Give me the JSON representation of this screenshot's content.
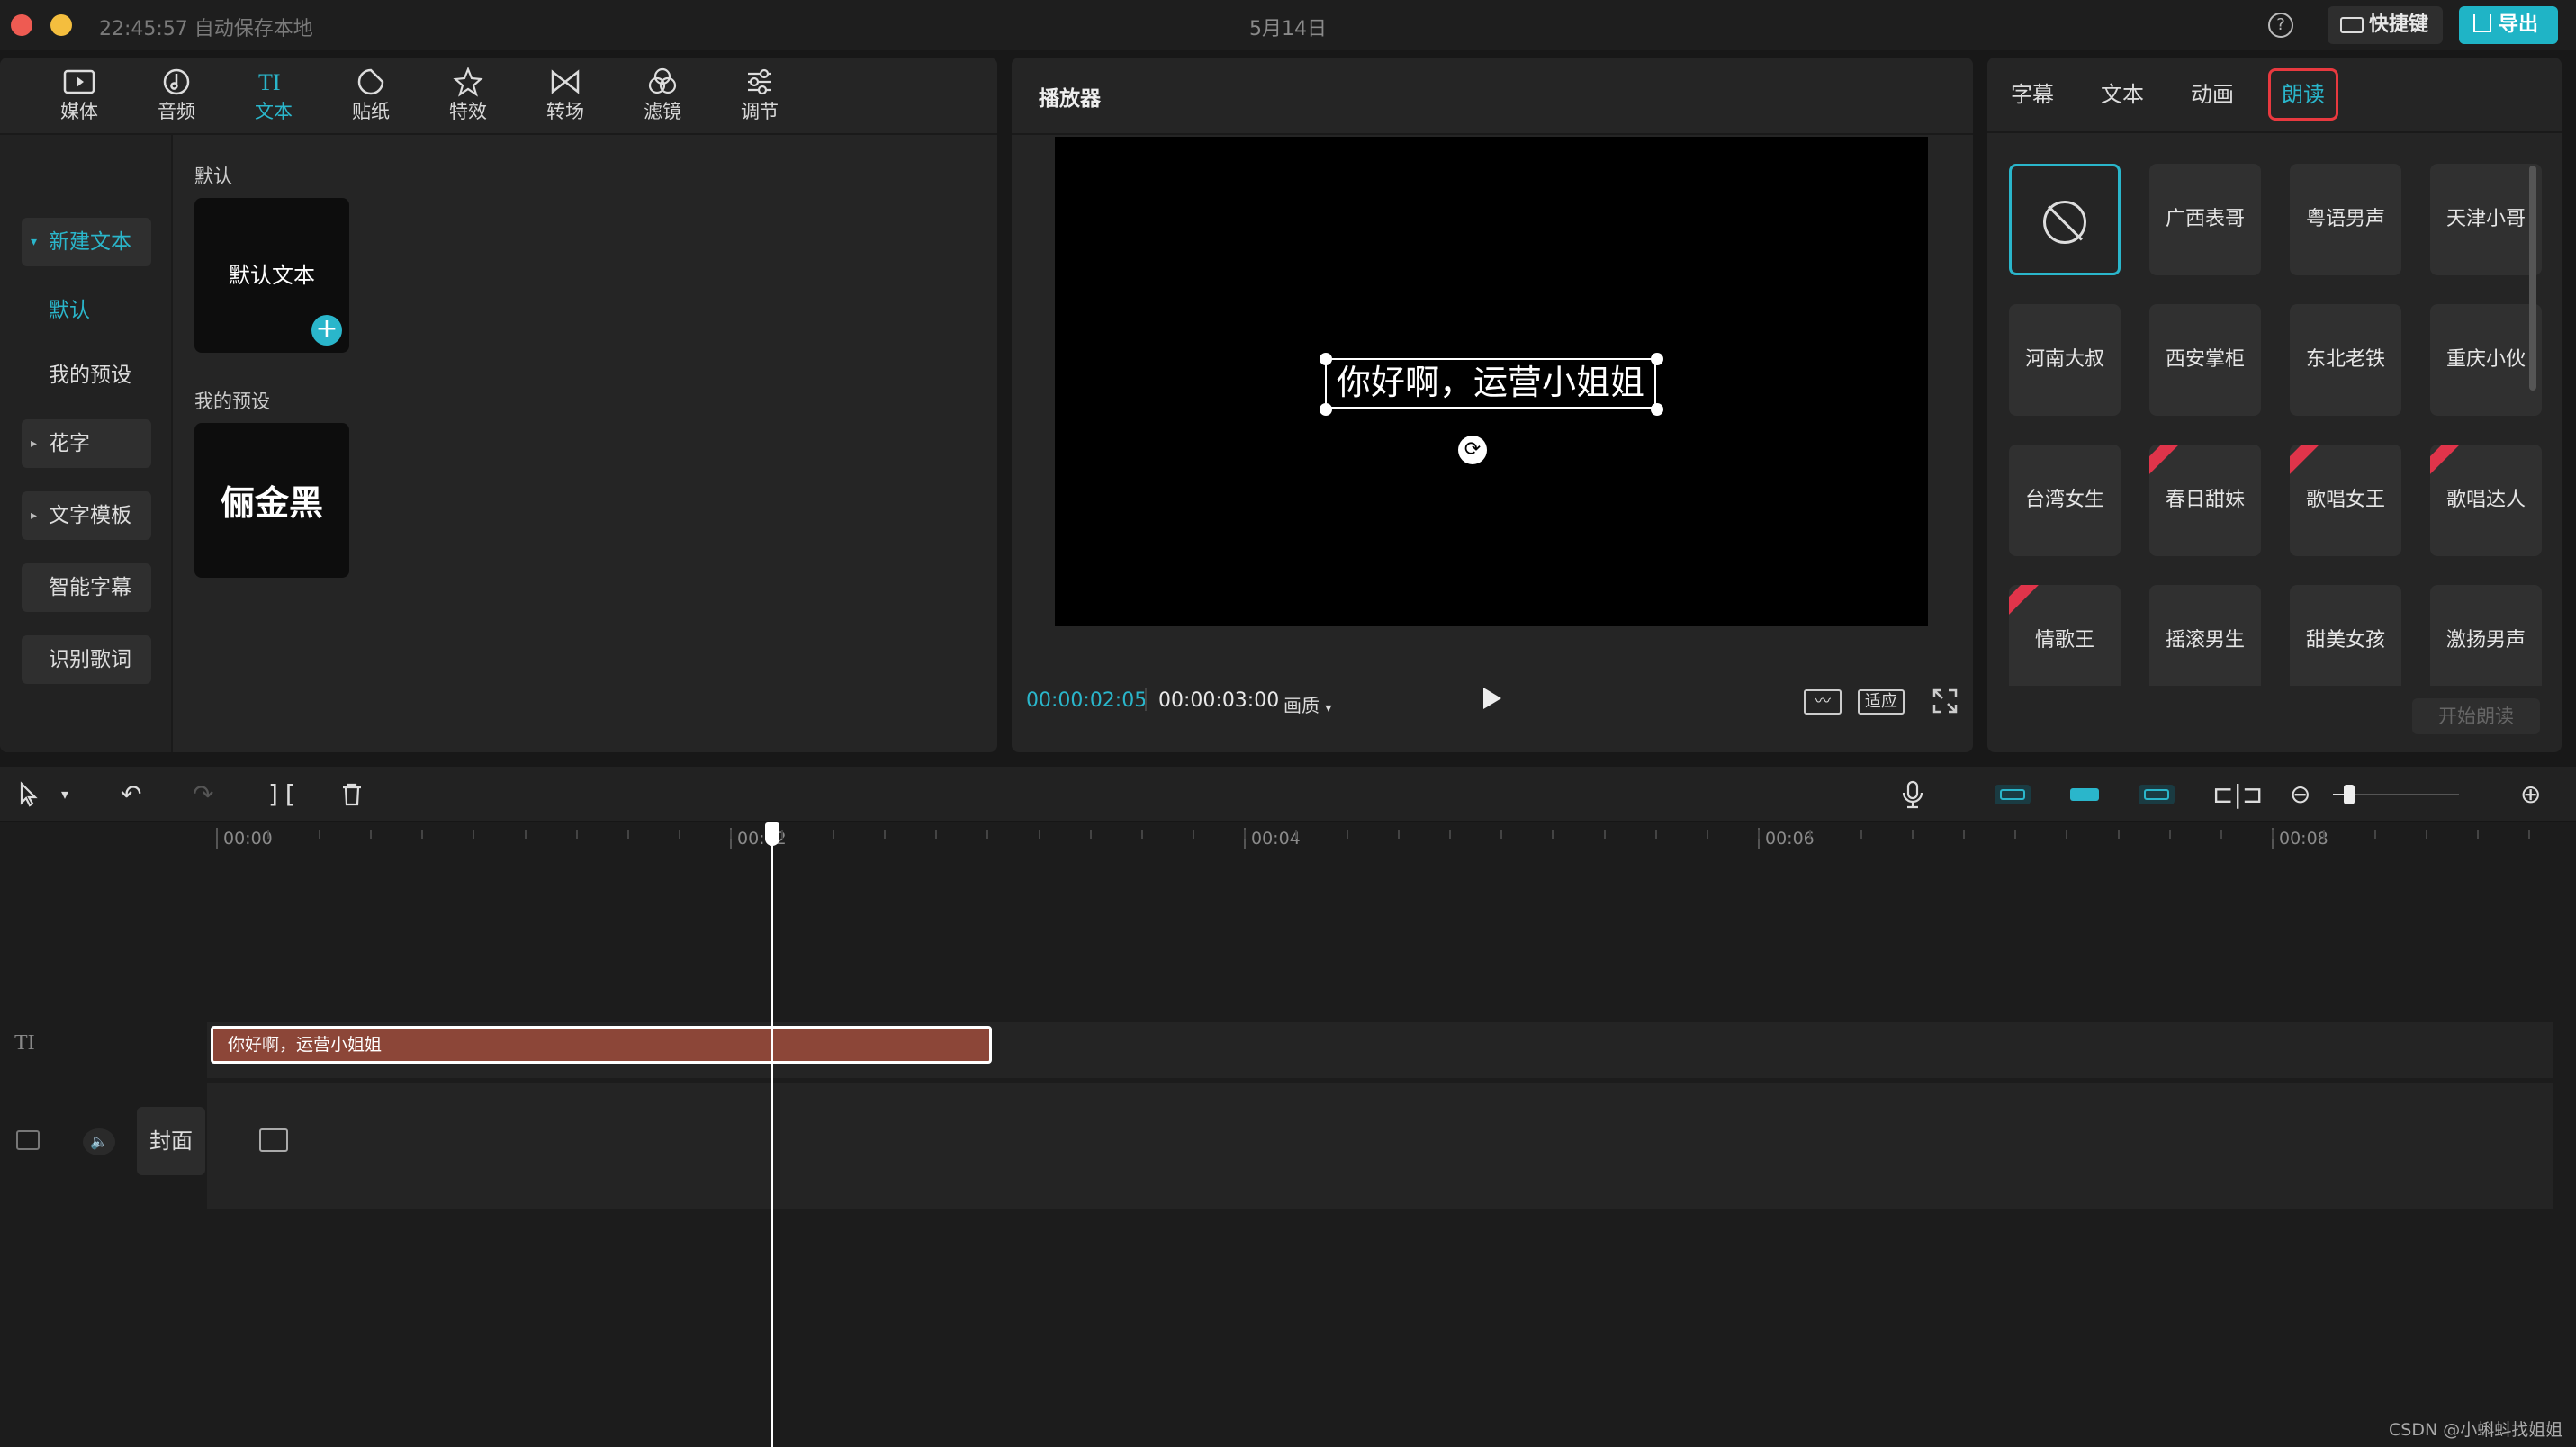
{
  "titlebar": {
    "autosave": "22:45:57 自动保存本地",
    "title": "5月14日",
    "help": "?",
    "shortcut_label": "快捷键",
    "export_label": "导出"
  },
  "tool_tabs": [
    {
      "label": "媒体",
      "icon": "media-icon"
    },
    {
      "label": "音频",
      "icon": "audio-icon"
    },
    {
      "label": "文本",
      "icon": "text-icon",
      "active": true
    },
    {
      "label": "贴纸",
      "icon": "sticker-icon"
    },
    {
      "label": "特效",
      "icon": "effects-icon"
    },
    {
      "label": "转场",
      "icon": "transition-icon"
    },
    {
      "label": "滤镜",
      "icon": "filter-icon"
    },
    {
      "label": "调节",
      "icon": "adjust-icon"
    }
  ],
  "left_nav": {
    "new_text": "新建文本",
    "default": "默认",
    "my_presets": "我的预设",
    "fancy_text": "花字",
    "text_templates": "文字模板",
    "smart_subtitles": "智能字幕",
    "recognize_lyrics": "识别歌词"
  },
  "presets": {
    "default_section": "默认",
    "default_card": "默认文本",
    "my_section": "我的预设",
    "my_card": "俪金黑"
  },
  "player": {
    "title": "播放器",
    "caption": "你好啊，运营小姐姐",
    "current_time": "00:00:02:05",
    "total_time": "00:00:03:00",
    "quality": "画质",
    "fit_label": "适应"
  },
  "right_panel": {
    "tabs": [
      "字幕",
      "文本",
      "动画",
      "朗读"
    ],
    "active_tab": "朗读",
    "voices": [
      "",
      "广西表哥",
      "粤语男声",
      "天津小哥",
      "河南大叔",
      "西安掌柜",
      "东北老铁",
      "重庆小伙",
      "台湾女生",
      "春日甜妹",
      "歌唱女王",
      "歌唱达人",
      "情歌王",
      "摇滚男生",
      "甜美女孩",
      "激扬男声"
    ],
    "start_read": "开始朗读"
  },
  "timeline": {
    "ruler": [
      "00:00",
      "00:02",
      "00:04",
      "00:06",
      "00:08"
    ],
    "text_clip": "你好啊，运营小姐姐",
    "cover": "封面",
    "text_track_icon": "TI"
  },
  "watermark": "CSDN @小蝌蚪找姐姐",
  "colors": {
    "accent": "#2ab6cb",
    "clip": "#8c4638",
    "highlight": "#e8393f"
  }
}
